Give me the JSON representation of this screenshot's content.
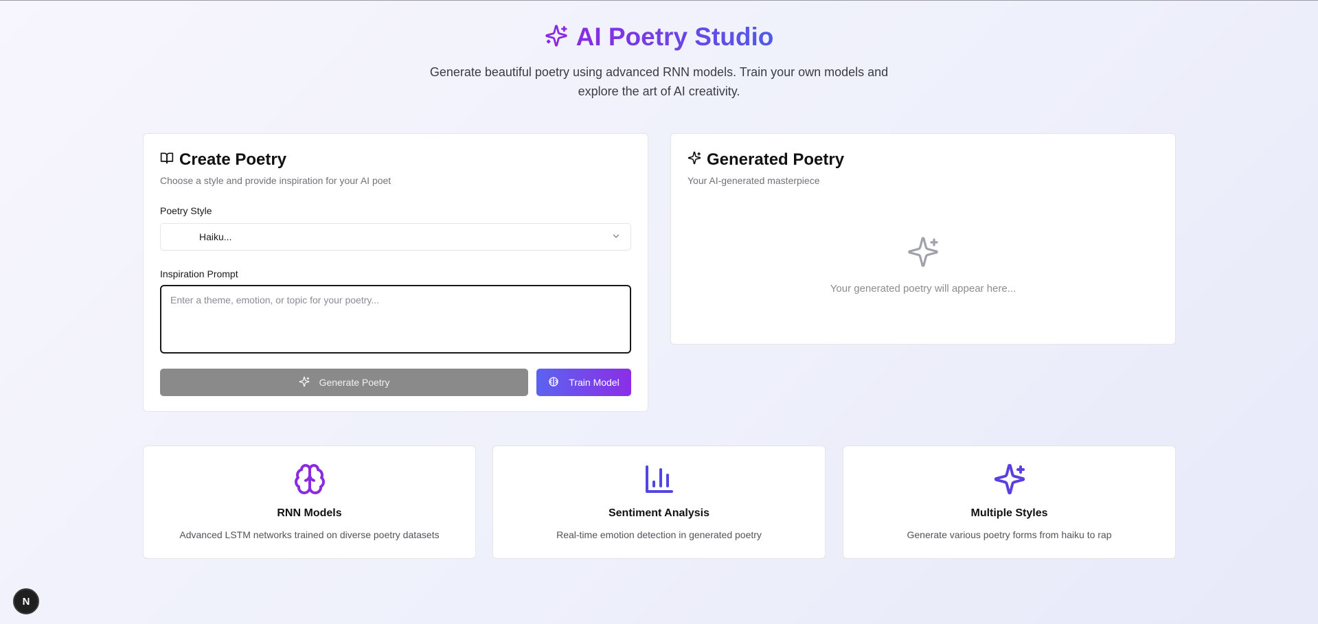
{
  "header": {
    "title": "AI Poetry Studio",
    "subtitle": "Generate beautiful poetry using advanced RNN models. Train your own models and explore the art of AI creativity.",
    "icon": "sparkles-icon"
  },
  "create": {
    "title": "Create Poetry",
    "description": "Choose a style and provide inspiration for your AI poet",
    "style_label": "Poetry Style",
    "style_value": "Haiku...",
    "prompt_label": "Inspiration Prompt",
    "prompt_placeholder": "Enter a theme, emotion, or topic for your poetry...",
    "prompt_value": "",
    "generate_label": "Generate Poetry",
    "train_label": "Train Model"
  },
  "generated": {
    "title": "Generated Poetry",
    "description": "Your AI-generated masterpiece",
    "empty_text": "Your generated poetry will appear here..."
  },
  "features": [
    {
      "title": "RNN Models",
      "description": "Advanced LSTM networks trained on diverse poetry datasets",
      "icon": "brain-icon"
    },
    {
      "title": "Sentiment Analysis",
      "description": "Real-time emotion detection in generated poetry",
      "icon": "bar-chart-icon"
    },
    {
      "title": "Multiple Styles",
      "description": "Generate various poetry forms from haiku to rap",
      "icon": "sparkles-icon"
    }
  ],
  "badge": {
    "label": "N"
  },
  "colors": {
    "purple": "#8a2be2",
    "indigo": "#4f5bea",
    "disabled": "#8a8a8a"
  }
}
